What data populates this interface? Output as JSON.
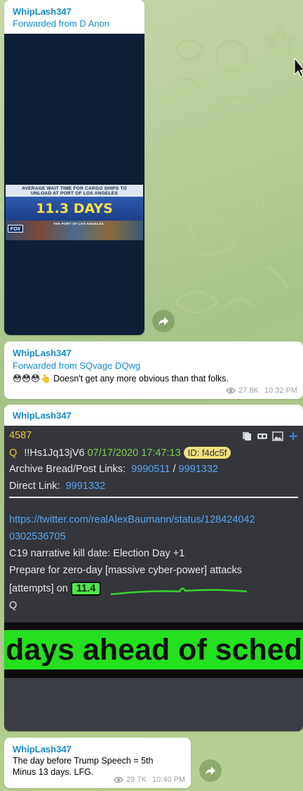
{
  "messages": [
    {
      "sender": "WhipLash347",
      "forwarded_from": "Forwarded from D Anon",
      "video": {
        "banner_line1": "AVERAGE WAIT TIME FOR CARGO SHIPS TO",
        "banner_line2": "UNLOAD AT PORT OF LOS ANGELES",
        "headline": "11.3 DAYS",
        "caption": "THE PORT OF LOS ANGELES",
        "logo": "FOX"
      }
    },
    {
      "sender": "WhipLash347",
      "forwarded_from": "Forwarded from SQvage DQwg",
      "emoji": "😳😳😳👆",
      "text": "Doesn't get any more obvious than that folks.",
      "views": "27.8K",
      "time": "10:32 PM"
    },
    {
      "sender": "WhipLash347",
      "qpost": {
        "number": "4587",
        "q": "Q",
        "trip": "!!Hs1Jq13jV6",
        "datetime": "07/17/2020 17:47:13",
        "id_label": "ID: f4dc5f",
        "archive_label": "Archive Bread/Post Links:",
        "archive_link1": "9990511",
        "archive_sep": "/",
        "archive_link2": "9991332",
        "direct_label": "Direct Link:",
        "direct_link": "9991332",
        "url_line1": "https://twitter.com/realAlexBaumann/status/128424042",
        "url_line2": "0302536705",
        "line1": "C19 narrative kill date: Election Day +1",
        "line2": "Prepare for zero-day [massive cyber-power] attacks",
        "line3_prefix": "[attempts] on",
        "highlight": "11.4",
        "sign": "Q"
      },
      "zoom_text": "days ahead of schedu"
    },
    {
      "sender": "WhipLash347",
      "text_line1": "The day before Trump Speech = 5th",
      "text_line2": "Minus 13 days. LFG.",
      "views": "29.7K",
      "time": "10:40 PM"
    }
  ],
  "colors": {
    "sender": "#168acd",
    "q_number": "#f3c43c",
    "q_date": "#7fd14a",
    "q_link": "#5aa6f2",
    "q_highlight": "#4ee64a",
    "zoom_green": "#24e01f"
  },
  "icons": [
    "share-icon",
    "eye-icon",
    "pointer-cursor-icon",
    "copy-icon",
    "vr-icon",
    "image-icon",
    "move-icon"
  ]
}
